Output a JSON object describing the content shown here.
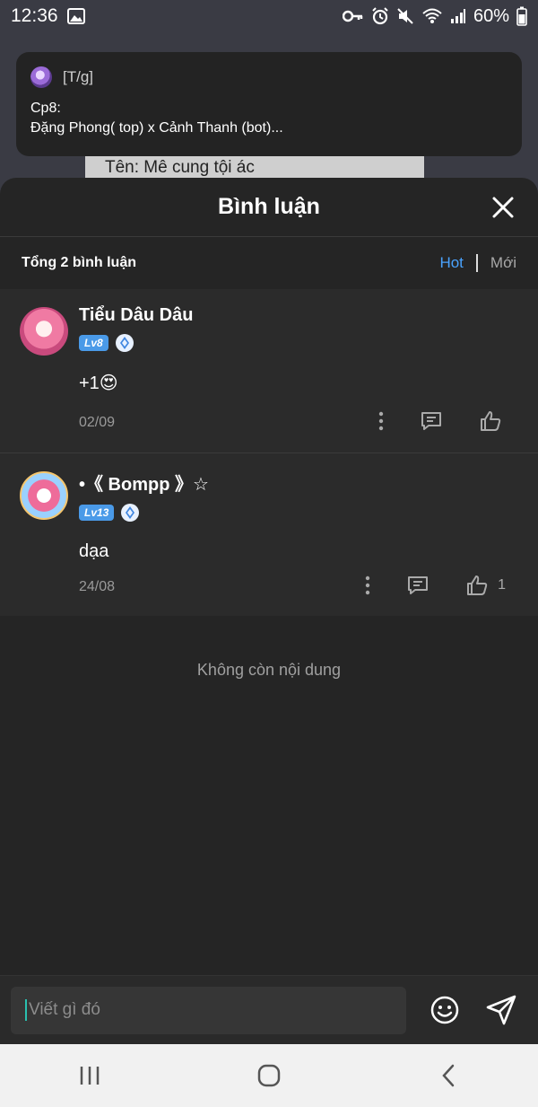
{
  "status_bar": {
    "time": "12:36",
    "battery": "60%"
  },
  "background": {
    "box_text": "Tên: Mê cung tội ác"
  },
  "notification": {
    "app_label": "[T/g]",
    "title": "Cp8:",
    "body": "Đặng Phong( top) x Cảnh Thanh (bot)..."
  },
  "sheet": {
    "title": "Bình luận",
    "total": "Tổng 2 bình luận",
    "sort_hot": "Hot",
    "sort_new": "Mới",
    "accent": "#4aa3ff"
  },
  "comments": [
    {
      "name": "Tiểu Dâu Dâu",
      "level": "Lv8",
      "text": "+1😍",
      "date": "02/09",
      "likes": ""
    },
    {
      "name": "•《 Bompp 》☆",
      "level": "Lv13",
      "text": "dạa",
      "date": "24/08",
      "likes": "1"
    }
  ],
  "empty_text": "Không còn nội dung",
  "input": {
    "placeholder": "Viết gì đó"
  },
  "icons": {
    "close": "close-icon",
    "more": "more-vertical-icon",
    "reply": "comment-icon",
    "like": "thumbs-up-icon",
    "emoji": "emoji-icon",
    "send": "send-icon"
  }
}
